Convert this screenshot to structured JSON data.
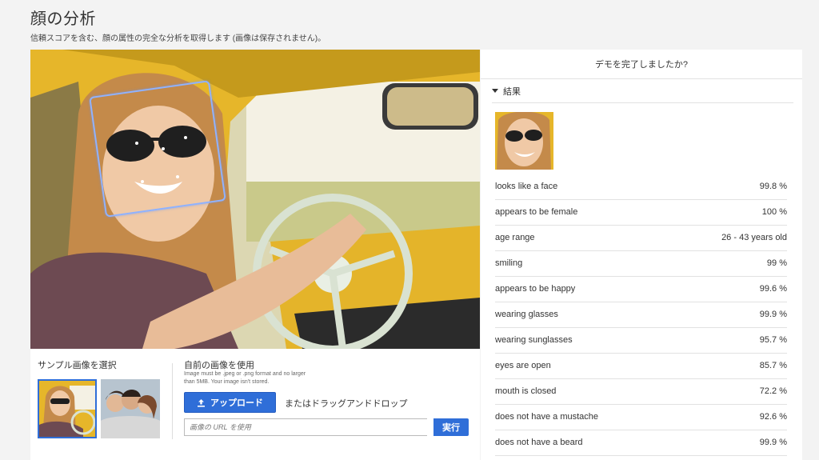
{
  "header": {
    "title": "顔の分析",
    "subtitle": "信頼スコアを含む、顔の属性の完全な分析を取得します (画像は保存されません)。"
  },
  "sample": {
    "label": "サンプル画像を選択"
  },
  "own_image": {
    "label": "自前の画像を使用",
    "hint": "Image must be .jpeg or .png format and no larger than 5MB. Your image isn't stored.",
    "upload_label": "アップロード",
    "drag_text": "またはドラッグアンドドロップ",
    "url_placeholder": "画像の URL を使用",
    "run_label": "実行"
  },
  "results_panel": {
    "demo_title": "デモを完了しましたか?",
    "results_label": "結果",
    "attributes": [
      {
        "name": "looks like a face",
        "value": "99.8 %"
      },
      {
        "name": "appears to be female",
        "value": "100 %"
      },
      {
        "name": "age range",
        "value": "26 - 43 years old"
      },
      {
        "name": "smiling",
        "value": "99 %"
      },
      {
        "name": "appears to be happy",
        "value": "99.6 %"
      },
      {
        "name": "wearing glasses",
        "value": "99.9 %"
      },
      {
        "name": "wearing sunglasses",
        "value": "95.7 %"
      },
      {
        "name": "eyes are open",
        "value": "85.7 %"
      },
      {
        "name": "mouth is closed",
        "value": "72.2 %"
      },
      {
        "name": "does not have a mustache",
        "value": "92.6 %"
      },
      {
        "name": "does not have a beard",
        "value": "99.9 %"
      }
    ]
  },
  "colors": {
    "accent": "#2f6ed8",
    "face_box": "#8fb2ff"
  }
}
